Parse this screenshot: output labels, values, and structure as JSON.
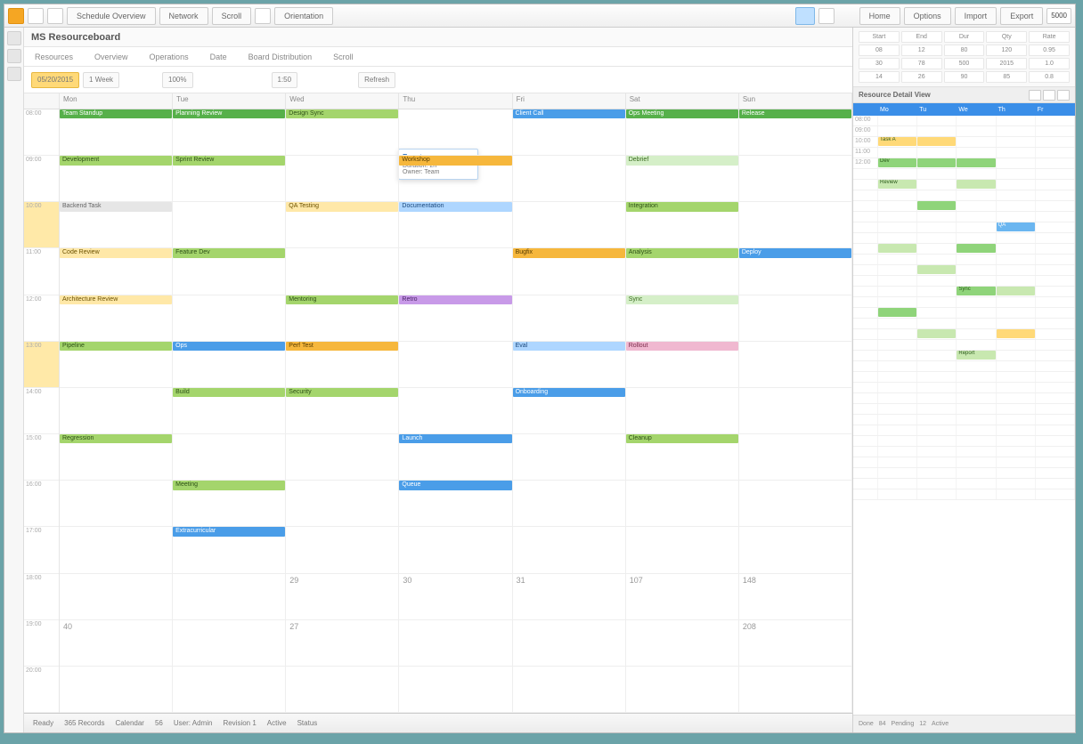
{
  "ribbon": {
    "tabs": [
      "Schedule Overview",
      "Network",
      "Scroll",
      "Orientation"
    ],
    "right": [
      "Home",
      "Options",
      "Import",
      "Export"
    ],
    "badge": "5000"
  },
  "window": {
    "title": "MS Resourceboard"
  },
  "tabrow": [
    "Resources",
    "Overview",
    "Operations",
    "Date",
    "Board Distribution",
    "Scroll"
  ],
  "toolbar": {
    "date": "05/20/2015",
    "view": "1 Week",
    "scale": "100%",
    "zoom": "1:50",
    "refresh": "Refresh"
  },
  "dayheaders": [
    "",
    "Mon",
    "Tue",
    "Wed",
    "Thu",
    "Fri",
    "Sat",
    "Sun"
  ],
  "timeslots": [
    "08:00",
    "09:00",
    "10:00",
    "11:00",
    "12:00",
    "13:00",
    "14:00",
    "15:00",
    "16:00",
    "17:00",
    "18:00",
    "19:00",
    "20:00"
  ],
  "side_times": [
    "08:00",
    "09:00",
    "10:00",
    "11:00",
    "12:00"
  ],
  "events": [
    [
      "Team Standup",
      "Planning Review",
      "Design Sync",
      "",
      "Client Call",
      "Ops Meeting",
      "Release"
    ],
    [
      "Development",
      "Sprint Review",
      "",
      "Workshop",
      "",
      "Debrief",
      ""
    ],
    [
      "Backend Task",
      "",
      "QA Testing",
      "Documentation",
      "",
      "Integration",
      ""
    ],
    [
      "Code Review",
      "Feature Dev",
      "",
      "",
      "Bugfix",
      "Analysis",
      "Deploy"
    ],
    [
      "Architecture Review",
      "",
      "Mentoring",
      "Retro",
      "",
      "Sync",
      ""
    ],
    [
      "Pipeline",
      "Ops",
      "Perf Test",
      "",
      "Eval",
      "Rollout",
      ""
    ],
    [
      "",
      "Build",
      "Security",
      "",
      "Onboarding",
      "",
      ""
    ],
    [
      "Regression",
      "",
      "",
      "Launch",
      "",
      "Cleanup",
      ""
    ],
    [
      "",
      "Meeting",
      "",
      "Queue",
      "",
      "",
      ""
    ],
    [
      "",
      "Extracurricular",
      "",
      "",
      "",
      "",
      ""
    ],
    [
      "",
      "",
      "",
      "",
      "",
      "",
      ""
    ],
    [
      "",
      "",
      "",
      "",
      "",
      "",
      ""
    ],
    [
      "",
      "",
      "",
      "",
      "",
      "",
      ""
    ]
  ],
  "event_styles": [
    [
      "g",
      "g",
      "gl",
      "",
      "b",
      "g",
      "g"
    ],
    [
      "gl",
      "gl",
      "",
      "y",
      "",
      "gp",
      ""
    ],
    [
      "gr",
      "",
      "yl",
      "bl",
      "",
      "gl",
      ""
    ],
    [
      "yl",
      "gl",
      "",
      "",
      "y",
      "gl",
      "b"
    ],
    [
      "yl",
      "",
      "gl",
      "p",
      "",
      "gp",
      ""
    ],
    [
      "gl",
      "b",
      "y",
      "",
      "bl",
      "pk",
      ""
    ],
    [
      "",
      "gl",
      "gl",
      "",
      "b",
      "",
      ""
    ],
    [
      "gl",
      "",
      "",
      "b",
      "",
      "gl",
      ""
    ],
    [
      "",
      "gl",
      "",
      "b",
      "",
      "",
      ""
    ],
    [
      "",
      "b",
      "",
      "",
      "",
      "",
      ""
    ],
    [
      "",
      "",
      "",
      "",
      "",
      "",
      ""
    ],
    [
      "",
      "",
      "",
      "",
      "",
      "",
      ""
    ],
    [
      "",
      "",
      "",
      "",
      "",
      "",
      ""
    ]
  ],
  "daynums": [
    null,
    null,
    null,
    null,
    null,
    null,
    null,
    null,
    null,
    "29",
    "30",
    "31",
    "107",
    "148",
    "40",
    "",
    "27",
    "",
    "",
    "",
    "208",
    "",
    "",
    "",
    "",
    "",
    ""
  ],
  "right_panel": {
    "stat_heads": [
      "Start",
      "End",
      "Dur",
      "Qty",
      "Rate"
    ],
    "stats": [
      [
        "08",
        "12",
        "80",
        "120",
        "0.95"
      ],
      [
        "30",
        "78",
        "500",
        "2015",
        "1.0"
      ],
      [
        "14",
        "26",
        "90",
        "85",
        "0.8"
      ]
    ],
    "title": "Resource Detail View",
    "days": [
      "",
      "Mo",
      "Tu",
      "We",
      "Th",
      "Fr"
    ],
    "rows": 12,
    "revents": [
      {
        "r": 1,
        "c": 1,
        "t": "Task A",
        "cls": "y"
      },
      {
        "r": 1,
        "c": 2,
        "t": "",
        "cls": "y"
      },
      {
        "r": 2,
        "c": 1,
        "t": "Dev",
        "cls": "g"
      },
      {
        "r": 2,
        "c": 2,
        "t": "",
        "cls": "g"
      },
      {
        "r": 2,
        "c": 3,
        "t": "",
        "cls": "g"
      },
      {
        "r": 3,
        "c": 1,
        "t": "Review",
        "cls": "gl"
      },
      {
        "r": 3,
        "c": 3,
        "t": "",
        "cls": "gl"
      },
      {
        "r": 4,
        "c": 2,
        "t": "",
        "cls": "g"
      },
      {
        "r": 5,
        "c": 4,
        "t": "QA",
        "cls": "b"
      },
      {
        "r": 6,
        "c": 1,
        "t": "",
        "cls": "gl"
      },
      {
        "r": 6,
        "c": 3,
        "t": "",
        "cls": "g"
      },
      {
        "r": 7,
        "c": 2,
        "t": "",
        "cls": "gl"
      },
      {
        "r": 8,
        "c": 3,
        "t": "Sync",
        "cls": "g"
      },
      {
        "r": 8,
        "c": 4,
        "t": "",
        "cls": "gl"
      },
      {
        "r": 9,
        "c": 1,
        "t": "",
        "cls": "g"
      },
      {
        "r": 10,
        "c": 2,
        "t": "",
        "cls": "gl"
      },
      {
        "r": 10,
        "c": 4,
        "t": "",
        "cls": "y"
      },
      {
        "r": 11,
        "c": 3,
        "t": "Report",
        "cls": "gl"
      }
    ]
  },
  "statusbar": [
    "Ready",
    "365 Records",
    "Calendar",
    "56",
    "User: Admin",
    "Revision 1",
    "Active",
    "Status"
  ],
  "rstatus": [
    "Done",
    "84",
    "Pending",
    "12",
    "Active"
  ],
  "popup": {
    "title": "Event",
    "line1": "Duration: 2h",
    "line2": "Owner: Team"
  }
}
